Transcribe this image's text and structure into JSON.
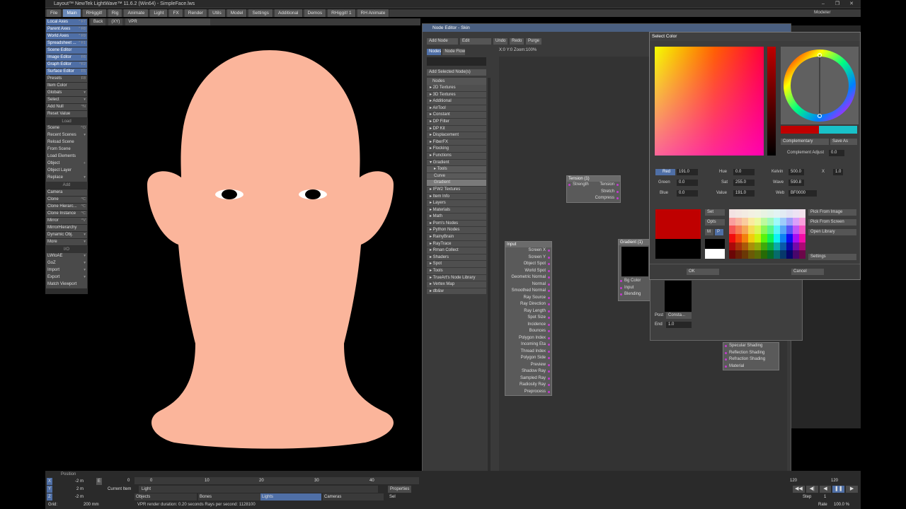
{
  "window": {
    "title": "Layout™ NewTek LightWave™ 11.6.2 (Win64) - SimpleFace.lws",
    "controls": [
      "–",
      "❐",
      "✕"
    ]
  },
  "menu_tabs": [
    "File",
    "Main",
    "RHiggit!",
    "Rig",
    "Animate",
    "Light",
    "FX",
    "Render",
    "Utils",
    "Model",
    "Settings",
    "Additional",
    "Demos",
    "RHiggit! 1",
    "RH Animate"
  ],
  "modeler_label": "Modeler",
  "left_panel": {
    "items": [
      {
        "label": "Local Axes",
        "key": "⌃F7",
        "blue": true
      },
      {
        "label": "Parent Axes",
        "key": "⌃F8",
        "blue": true
      },
      {
        "label": "World Axes",
        "key": "⌃F9",
        "blue": true
      },
      {
        "label": "Spreadsheet ...",
        "key": "⌃F1",
        "blue": true
      },
      {
        "label": "Scene Editor",
        "key": "",
        "blue": true
      },
      {
        "label": "Image Editor",
        "key": "F6",
        "blue": true
      },
      {
        "label": "Graph Editor",
        "key": "^F2",
        "blue": true
      },
      {
        "label": "Surface Editor",
        "key": "F5",
        "blue": true
      },
      {
        "label": "Presets",
        "key": "F8",
        "blue": false
      },
      {
        "label": "Item Color",
        "key": "",
        "blue": false
      },
      {
        "label": "Globals",
        "key": "▾",
        "blue": false
      },
      {
        "label": "Select",
        "key": "▾",
        "blue": false
      },
      {
        "label": "Add Null",
        "key": "^N",
        "blue": false
      },
      {
        "label": "Reset Value",
        "key": "",
        "blue": false
      }
    ],
    "load_header": "Load",
    "load_items": [
      {
        "label": "Scene",
        "key": "^O"
      },
      {
        "label": "Recent Scenes",
        "key": "▾"
      },
      {
        "label": "Reload Scene",
        "key": ""
      },
      {
        "label": "From Scene",
        "key": ""
      },
      {
        "label": "Load Elements",
        "key": ""
      },
      {
        "label": "Object",
        "key": "+"
      },
      {
        "label": "Object Layer",
        "key": ""
      },
      {
        "label": "Replace",
        "key": "▾"
      }
    ],
    "add_header": "Add",
    "add_items": [
      {
        "label": "Camera",
        "key": ""
      },
      {
        "label": "Clone",
        "key": "^C"
      },
      {
        "label": "Clone Hierarc...",
        "key": "^C"
      },
      {
        "label": "Clone Instance",
        "key": "^C"
      },
      {
        "label": "Mirror",
        "key": "^V"
      },
      {
        "label": "MirrorHierarchy",
        "key": ""
      },
      {
        "label": "Dynamic Obj.",
        "key": "▾"
      },
      {
        "label": "More",
        "key": "▾"
      }
    ],
    "io_header": "I/O",
    "io_items": [
      {
        "label": "LWtoAE",
        "key": "▾"
      },
      {
        "label": "GoZ",
        "key": "▾"
      },
      {
        "label": "Import",
        "key": "▾"
      },
      {
        "label": "Export",
        "key": "▾"
      },
      {
        "label": "Match Viewport",
        "key": ""
      }
    ]
  },
  "viewport": {
    "view_mode": "Back",
    "axis": "(XY)",
    "render_mode": "VPR"
  },
  "node_editor": {
    "title": "Node Editor - Skin",
    "add_node": "Add Node",
    "edit": "Edit",
    "undo": "Undo",
    "redo": "Redo",
    "purge": "Purge",
    "tabs": [
      "Nodes",
      "Node Flow"
    ],
    "coords": "X:0 Y:0 Zoom:100%",
    "add_selected": "Add Selected Node(s)",
    "list_header": "Nodes",
    "categories": [
      {
        "label": "▸ 2D Textures",
        "type": "cat"
      },
      {
        "label": "▸ 3D Textures",
        "type": "cat"
      },
      {
        "label": "▸ Additional",
        "type": "cat"
      },
      {
        "label": "▸ AirTool",
        "type": "cat"
      },
      {
        "label": "▸ Constant",
        "type": "cat"
      },
      {
        "label": "▸ DP Filter",
        "type": "cat"
      },
      {
        "label": "▸ DP Kit",
        "type": "cat"
      },
      {
        "label": "▸ Displacement",
        "type": "cat"
      },
      {
        "label": "▸ FiberFX",
        "type": "cat"
      },
      {
        "label": "▸ Flocking",
        "type": "cat"
      },
      {
        "label": "▸ Functions",
        "type": "cat"
      },
      {
        "label": "▾ Gradient",
        "type": "cat"
      },
      {
        "label": "▸ Tools",
        "type": "sub"
      },
      {
        "label": "Curve",
        "type": "sub"
      },
      {
        "label": "Gradient",
        "type": "sel"
      },
      {
        "label": "▸ IFW2 Textures",
        "type": "cat"
      },
      {
        "label": "▸ Item Info",
        "type": "cat"
      },
      {
        "label": "▸ Layers",
        "type": "cat"
      },
      {
        "label": "▸ Materials",
        "type": "cat"
      },
      {
        "label": "▸ Math",
        "type": "cat"
      },
      {
        "label": "▸ Pom's Nodes",
        "type": "cat"
      },
      {
        "label": "▸ Python Nodes",
        "type": "cat"
      },
      {
        "label": "▸ RainyBrain",
        "type": "cat"
      },
      {
        "label": "▸ RayTrace",
        "type": "cat"
      },
      {
        "label": "▸ Rman Collect",
        "type": "cat"
      },
      {
        "label": "▸ Shaders",
        "type": "cat"
      },
      {
        "label": "▸ Spot",
        "type": "cat"
      },
      {
        "label": "▸ Tools",
        "type": "cat"
      },
      {
        "label": "▸ TrueArt's Node Library",
        "type": "cat"
      },
      {
        "label": "▸ Vertex Map",
        "type": "cat"
      },
      {
        "label": "▸ db&w",
        "type": "cat"
      }
    ],
    "tension_node": {
      "title": "Tension (1)",
      "inputs": [
        "Strength"
      ],
      "outputs": [
        "Tension",
        "Stretch",
        "Compress"
      ]
    },
    "input_node": {
      "title": "Input",
      "outputs": [
        "Screen X",
        "Screen Y",
        "Object Spot",
        "World Spot",
        "Geometric Normal",
        "Normal",
        "Smoothed Normal",
        "Ray Source",
        "Ray Direction",
        "Ray Length",
        "Spot Size",
        "Incidence",
        "Bounces",
        "Polygon Index",
        "Incoming Eta",
        "Thread Index",
        "Polygon Side",
        "Preview",
        "Shadow Ray",
        "Sampled Ray",
        "Radiosity Ray",
        "Preprocess"
      ]
    },
    "gradient_node": {
      "title": "Gradient (1)",
      "inputs": [
        "Bg Color",
        "Input",
        "Blending"
      ]
    },
    "surface_node": {
      "inputs": [
        "Specular Shading",
        "Reflection Shading",
        "Refraction Shading",
        "Material"
      ]
    },
    "post_label": "Post",
    "post_value": "Consta...",
    "end_label": "End",
    "end_value": "1.0"
  },
  "select_color": {
    "title": "Select Color",
    "harmony": "Complementary",
    "save_as": "Save As",
    "complement_adjust_label": "Complement Adjust",
    "complement_adjust_value": "0.0",
    "red_label": "Red",
    "red_value": "191.0",
    "green_label": "Green",
    "green_value": "0.0",
    "blue_label": "Blue",
    "blue_value": "0.0",
    "hue_label": "Hue",
    "hue_value": "0.0",
    "sat_label": "Sat",
    "sat_value": "255.0",
    "value_label": "Value",
    "value_value": "191.0",
    "kelvin_label": "Kelvin",
    "kelvin_value": "500.0",
    "x_label": "X",
    "x_value": "1.0",
    "wave_label": "Wave",
    "wave_value": "590.8",
    "web_label": "Web",
    "web_value": "BF0000",
    "set": "Set",
    "opts": "Opts",
    "m": "M",
    "p": "P",
    "pick_from_image": "Pick From Image",
    "pick_from_screen": "Pick From Screen",
    "open_library": "Open Library",
    "settings": "Settings",
    "ok": "OK",
    "cancel": "Cancel",
    "current_color": "#bf0000",
    "complement_color": "#19c1c8"
  },
  "bottom": {
    "position_label": "Position",
    "x_label": "X",
    "x_value": "-2 m",
    "y_label": "Y",
    "y_value": "2 m",
    "z_label": "Z",
    "z_value": "-2 m",
    "e_label": "E",
    "grid_label": "Grid:",
    "grid_value": "200 mm",
    "timeline_ticks": [
      "0",
      "0",
      "10",
      "20",
      "30",
      "40"
    ],
    "current_item_label": "Current Item",
    "current_item_value": "Light",
    "objects": "Objects",
    "bones": "Bones",
    "lights": "Lights",
    "cameras": "Cameras",
    "sel": "Sel",
    "properties": "Properties",
    "status": "VPR render duration: 0.20 seconds  Rays per second: 1128100",
    "end_frame_a": "120",
    "end_frame_b": "120",
    "step_label": "Step",
    "step_value": "1",
    "rate_label": "Rate",
    "rate_value": "100.0 %"
  }
}
